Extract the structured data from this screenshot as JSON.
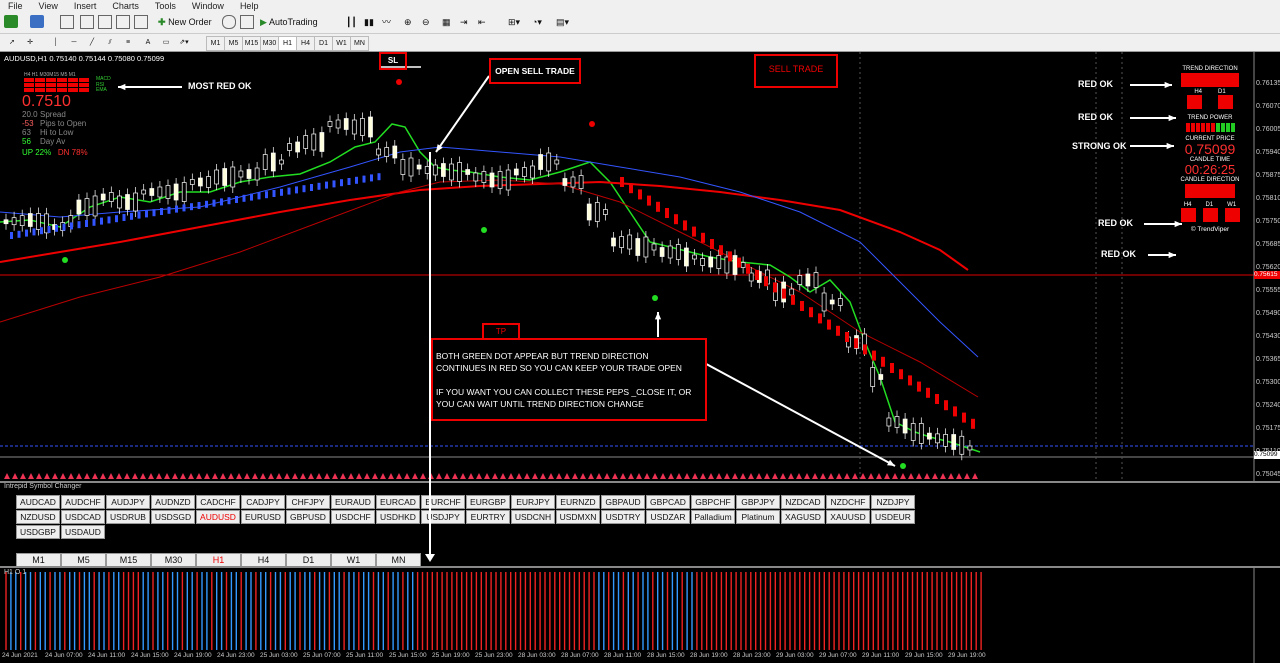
{
  "menu": [
    "File",
    "View",
    "Insert",
    "Charts",
    "Tools",
    "Window",
    "Help"
  ],
  "toolbar": {
    "new_order": "New Order",
    "autotrading": "AutoTrading"
  },
  "toolbar_tfs": [
    "M1",
    "M5",
    "M15",
    "M30",
    "H1",
    "H4",
    "D1",
    "W1",
    "MN"
  ],
  "chart": {
    "title": "AUDUSD,H1  0.75140 0.75144 0.75080 0.75099",
    "mini_header": "H4  H1  M30M15  M5  M1",
    "mini_labels": [
      "MACD",
      "RSI",
      "EMA"
    ],
    "big_price": "0.7510",
    "stats": [
      {
        "val": "20.0",
        "label": "Spread",
        "color": "#888888"
      },
      {
        "val": "-53",
        "label": "Pips to Open",
        "color": "#ff6060"
      },
      {
        "val": "63",
        "label": "Hi to Low",
        "color": "#888888"
      },
      {
        "val": "56",
        "label": "Day Av",
        "color": "#33ff33"
      }
    ],
    "up": "UP 22%",
    "dn": "DN 78%",
    "price_labels": [
      "0.76135",
      "0.76070",
      "0.76005",
      "0.75940",
      "0.75875",
      "0.75810",
      "0.75750",
      "0.75685",
      "0.75620",
      "0.75555",
      "0.75490",
      "0.75430",
      "0.75365",
      "0.75300",
      "0.75240",
      "0.75175",
      "0.75110",
      "0.75045"
    ],
    "current_price_tag": "0.75099",
    "line_price_tag": "0.75615"
  },
  "annotations": {
    "sl": "SL",
    "open_sell": "OPEN SELL TRADE",
    "sell_trade": "SELL TRADE",
    "most_red": "MOST RED OK",
    "tp": "TP",
    "note_lines": [
      "BOTH GREEN DOT APPEAR BUT TREND DIRECTION",
      "CONTINUES IN RED SO YOU CAN KEEP YOUR TRADE OPEN",
      "",
      "IF YOU WANT YOU CAN COLLECT THESE PEPS _CLOSE IT, OR",
      "YOU CAN WAIT UNTIL TREND DIRECTION CHANGE"
    ],
    "red_ok_1": "RED OK",
    "red_ok_2": "RED OK",
    "strong_ok": "STRONG OK",
    "red_ok_3": "RED OK",
    "red_ok_4": "RED OK"
  },
  "panel": {
    "trend_direction": "TREND DIRECTION",
    "h4": "H4",
    "d1": "D1",
    "trend_power": "TREND POWER",
    "current_price_label": "CURRENT PRICE",
    "current_price": "0.75099",
    "candle_time_label": "CANDLE TIME",
    "candle_time": "00:26:25",
    "candle_direction": "CANDLE DIRECTION",
    "cd_h4": "H4",
    "cd_d1": "D1",
    "cd_w1": "W1",
    "copyright": "© TrendViper"
  },
  "symbol_changer": {
    "title": "Intrepid Symbol Changer",
    "symbols": [
      "AUDCAD",
      "AUDCHF",
      "AUDJPY",
      "AUDNZD",
      "CADCHF",
      "CADJPY",
      "CHFJPY",
      "EURAUD",
      "EURCAD",
      "EURCHF",
      "EURGBP",
      "EURJPY",
      "EURNZD",
      "GBPAUD",
      "GBPCAD",
      "GBPCHF",
      "GBPJPY",
      "NZDCAD",
      "NZDCHF",
      "NZDJPY",
      "NZDUSD",
      "USDCAD",
      "USDRUB",
      "USDSGD",
      "AUDUSD",
      "EURUSD",
      "GBPUSD",
      "USDCHF",
      "USDHKD",
      "USDJPY",
      "EURTRY",
      "USDCNH",
      "USDMXN",
      "USDTRY",
      "USDZAR",
      "Palladium",
      "Platinum",
      "XAGUSD",
      "XAUUSD",
      "USDEUR",
      "USDGBP",
      "USDAUD"
    ],
    "active": "AUDUSD",
    "timeframes": [
      "M1",
      "M5",
      "M15",
      "M30",
      "H1",
      "H4",
      "D1",
      "W1",
      "MN"
    ],
    "active_tf": "H1"
  },
  "oscillator": {
    "label": "H1 O 1"
  },
  "time_labels": [
    "24 Jun 2021",
    "24 Jun 07:00",
    "24 Jun 11:00",
    "24 Jun 15:00",
    "24 Jun 19:00",
    "24 Jun 23:00",
    "25 Jun 03:00",
    "25 Jun 07:00",
    "25 Jun 11:00",
    "25 Jun 15:00",
    "25 Jun 19:00",
    "25 Jun 23:00",
    "28 Jun 03:00",
    "28 Jun 07:00",
    "28 Jun 11:00",
    "28 Jun 15:00",
    "28 Jun 19:00",
    "28 Jun 23:00",
    "29 Jun 03:00",
    "29 Jun 07:00",
    "29 Jun 11:00",
    "29 Jun 15:00",
    "29 Jun 19:00"
  ],
  "colors": {
    "bull": "#ffffff",
    "bear": "#ffffcc",
    "accent": "#ff0000",
    "ma_fast": "#22dd22",
    "ma_blue": "#3355ff",
    "osc_red": "#ee2222",
    "osc_blue": "#3399ff"
  }
}
